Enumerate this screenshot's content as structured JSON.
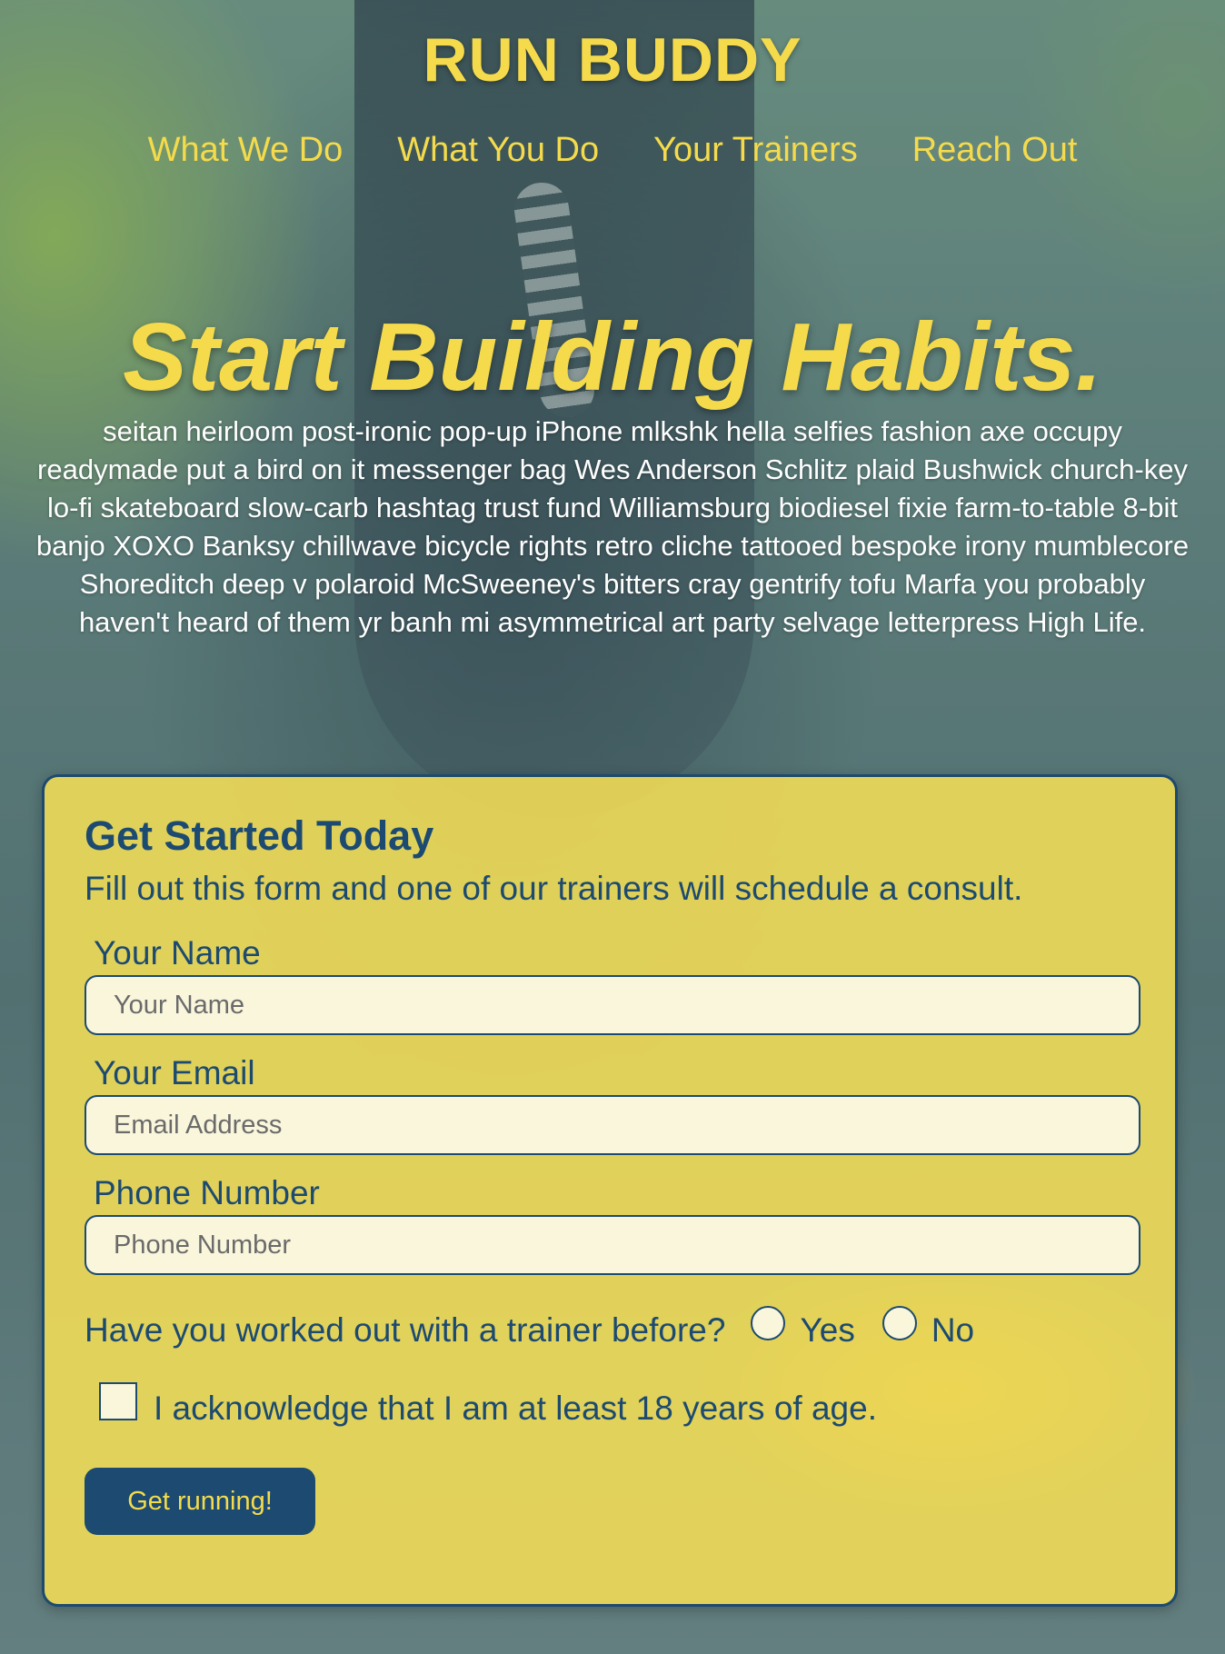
{
  "colors": {
    "accent_yellow": "#f5db4c",
    "navy": "#1c4a70",
    "card_bg": "#f4de56",
    "input_bg": "#faf6dc"
  },
  "header": {
    "title": "RUN BUDDY",
    "nav": [
      {
        "label": "What We Do"
      },
      {
        "label": "What You Do"
      },
      {
        "label": "Your Trainers"
      },
      {
        "label": "Reach Out"
      }
    ]
  },
  "hero": {
    "title": "Start Building Habits.",
    "text": "seitan heirloom post-ironic pop-up iPhone mlkshk hella selfies fashion axe occupy readymade put a bird on it messenger bag Wes Anderson Schlitz plaid Bushwick church-key lo-fi skateboard slow-carb hashtag trust fund Williamsburg biodiesel fixie farm-to-table 8-bit banjo XOXO Banksy chillwave bicycle rights retro cliche tattooed bespoke irony mumblecore Shoreditch deep v polaroid McSweeney's bitters cray gentrify tofu Marfa you probably haven't heard of them yr banh mi asymmetrical art party selvage letterpress High Life."
  },
  "form": {
    "title": "Get Started Today",
    "subtitle": "Fill out this form and one of our trainers will schedule a consult.",
    "fields": [
      {
        "label": "Your Name",
        "placeholder": "Your Name",
        "value": ""
      },
      {
        "label": "Your Email",
        "placeholder": "Email Address",
        "value": ""
      },
      {
        "label": "Phone Number",
        "placeholder": "Phone Number",
        "value": ""
      }
    ],
    "trainer_question": "Have you worked out with a trainer before?",
    "options": [
      {
        "label": "Yes",
        "selected": false
      },
      {
        "label": "No",
        "selected": false
      }
    ],
    "age_ack": "I acknowledge that I am at least 18 years of age.",
    "age_checked": false,
    "submit_label": "Get running!"
  }
}
